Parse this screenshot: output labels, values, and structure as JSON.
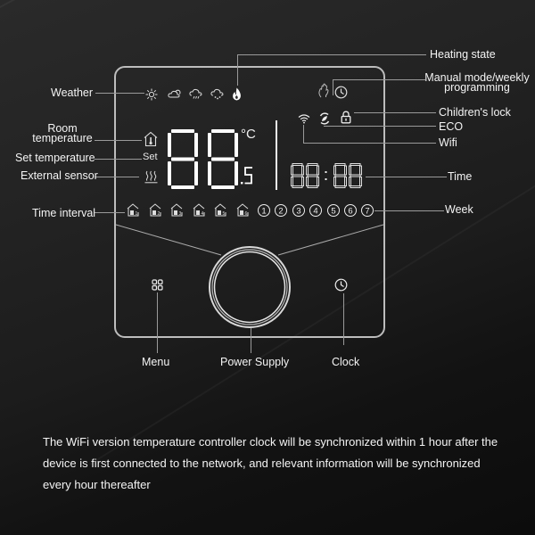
{
  "labels": {
    "heating_state": "Heating state",
    "manual_mode": "Manual mode/weekly programming",
    "manual_mode_line1": "Manual mode/weekly",
    "manual_mode_line2": "programming",
    "weather": "Weather",
    "childrens_lock": "Children's lock",
    "eco": "ECO",
    "wifi": "Wifi",
    "room_temperature_line1": "Room",
    "room_temperature_line2": "temperature",
    "set_temperature": "Set temperature",
    "external_sensor": "External sensor",
    "time": "Time",
    "time_interval": "Time interval",
    "week": "Week",
    "menu": "Menu",
    "power_supply": "Power Supply",
    "clock": "Clock"
  },
  "display": {
    "set_text": "Set",
    "temperature_digits": "88",
    "temperature_decimal": ".5",
    "temperature_unit": "°C",
    "time_digits": "88:88",
    "weather_icons": [
      "sun-icon",
      "cloudy-icon",
      "rain-icon",
      "snow-icon"
    ],
    "time_interval_icons": [
      "1",
      "2",
      "3",
      "4",
      "5",
      "6"
    ],
    "week_days": [
      "①",
      "②",
      "③",
      "④",
      "⑤",
      "⑥",
      "⑦"
    ]
  },
  "description": "The WiFi version temperature controller clock will be synchronized within 1 hour after the device is first connected to the network, and relevant information will be synchronized every hour thereafter"
}
